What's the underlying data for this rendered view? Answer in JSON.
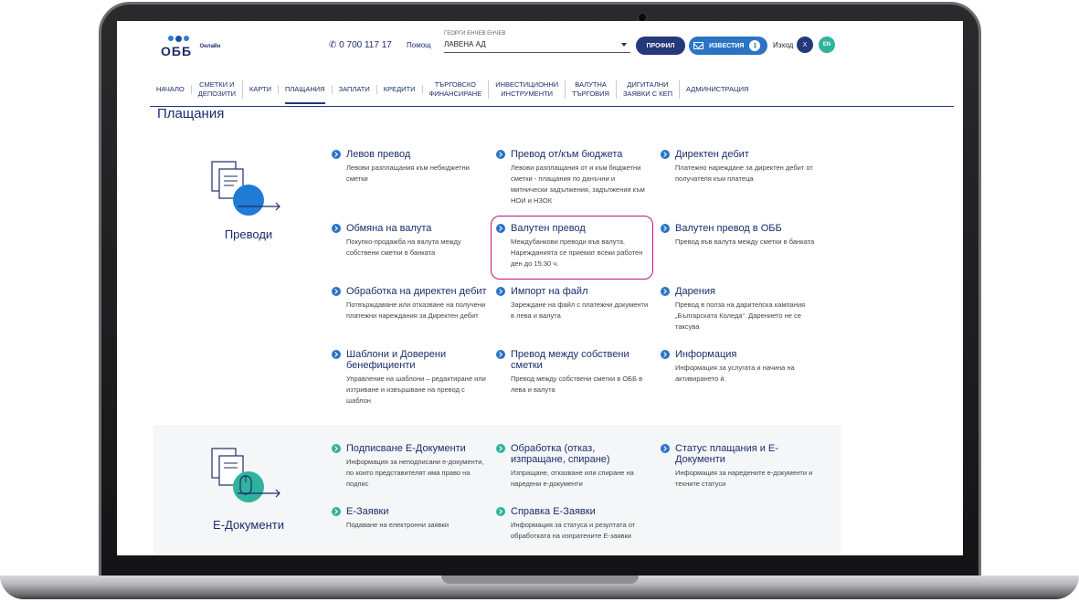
{
  "header": {
    "logo_text": "ОББ",
    "logo_sub": "Онлайн",
    "phone": "0 700 117 17",
    "help": "Помощ",
    "company_label": "ГЕОРГИ ЕНЧЕВ ЕНЧЕВ",
    "company_value": "ЛАВЕНА АД",
    "profile_label": "ПРОФИЛ",
    "news_label": "ИЗВЕСТИЯ",
    "news_count": "1",
    "logout_label": "Изход",
    "x_label": "X",
    "lang_label": "EN"
  },
  "nav": [
    {
      "line1": "НАЧАЛО",
      "line2": ""
    },
    {
      "line1": "СМЕТКИ И",
      "line2": "ДЕПОЗИТИ"
    },
    {
      "line1": "КАРТИ",
      "line2": ""
    },
    {
      "line1": "ПЛАЩАНИЯ",
      "line2": ""
    },
    {
      "line1": "ЗАПЛАТИ",
      "line2": ""
    },
    {
      "line1": "КРЕДИТИ",
      "line2": ""
    },
    {
      "line1": "ТЪРГОВСКО",
      "line2": "ФИНАНСИРАНЕ"
    },
    {
      "line1": "ИНВЕСТИЦИОННИ",
      "line2": "ИНСТРУМЕНТИ"
    },
    {
      "line1": "ВАЛУТНА",
      "line2": "ТЪРГОВИЯ"
    },
    {
      "line1": "ДИГИТАЛНИ",
      "line2": "ЗАЯВКИ С КЕП"
    },
    {
      "line1": "АДМИНИСТРАЦИЯ",
      "line2": ""
    }
  ],
  "page_title": "Плащания",
  "transfers": {
    "label": "Преводи",
    "links": [
      {
        "title": "Левов превод",
        "desc": "Левови разплащания към небюджетни сметки"
      },
      {
        "title": "Превод от/към бюджета",
        "desc": "Левови разплащания от и към бюджетни сметки - плащания по данъчни и митнически задължения, задължения към НОИ и НЗОК"
      },
      {
        "title": "Директен дебит",
        "desc": "Платежно нареждане за директен дебит от получателя към платеца"
      },
      {
        "title": "Обмяна на валута",
        "desc": "Покупко-продажба на валута между собствени сметки в банката"
      },
      {
        "title": "Валутен превод",
        "desc": "Междубанкови преводи във валута. Нарежданията се приемат всеки работен ден до 15:30 ч."
      },
      {
        "title": "Валутен превод в ОББ",
        "desc": "Превод във валута между сметки в банката"
      },
      {
        "title": "Обработка на директен дебит",
        "desc": "Потвърждаване или отказване на получени платежни нареждания за Директен дебит"
      },
      {
        "title": "Импорт на файл",
        "desc": "Зареждане на файл с платежни документи в лева и валута"
      },
      {
        "title": "Дарения",
        "desc": "Превод в полза на дарителска кампания „Българската Коледа“. Дарението не се таксува"
      },
      {
        "title": "Шаблони и Доверени бенефициенти",
        "desc": "Управление на шаблони – редактиране или изтриване и извършване на превод с шаблон"
      },
      {
        "title": "Превод между собствени сметки",
        "desc": "Превод между собствени сметки в ОББ в лева и валута"
      },
      {
        "title": "Информация",
        "desc": "Информация за услугата и начина на активирането ѝ."
      }
    ]
  },
  "edocs": {
    "label": "Е-Документи",
    "links": [
      {
        "title": "Подписване Е-Документи",
        "desc": "Информация за неподписани е-документи, по които представителят има право на подпис"
      },
      {
        "title": "Обработка (отказ, изпращане, спиране)",
        "desc": "Изпращане, отказване или спиране на наредени е-документи"
      },
      {
        "title": "Статус плащания и Е-Документи",
        "desc": "Информация за наредените е-документи и техните статуси"
      },
      {
        "title": "Е-Заявки",
        "desc": "Подаване на електронни заявки"
      },
      {
        "title": "Справка Е-Заявки",
        "desc": "Информация за статуса и резултата от обработката на изпратените Е-заявки"
      }
    ]
  },
  "colors": {
    "primary": "#24397a",
    "accent_blue": "#2b74c4",
    "accent_teal": "#2fb39c",
    "highlight": "#c0117a"
  }
}
